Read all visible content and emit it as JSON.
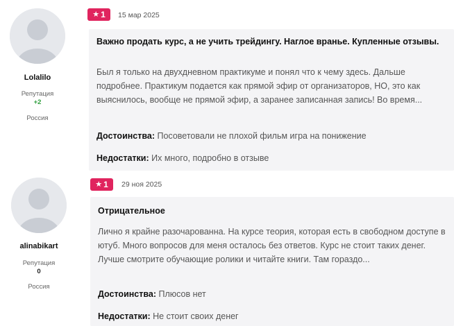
{
  "reviews": [
    {
      "rating": "1",
      "date": "15 мар 2025",
      "author": "Lolalilo",
      "reputation_label": "Репутация",
      "reputation": "+2",
      "reputation_color": "#2e9e3c",
      "country": "Россия",
      "title": "Важно продать курс, а не учить трейдингу. Наглое вранье. Купленные отзывы.",
      "text": "Был я только на двухдневном практикуме и понял что к чему здесь. Дальше подробнее. Практикум подается как прямой эфир от организаторов, НО, это как выяснилось, вообще не прямой эфир, а заранее записанная запись! Во время...",
      "pros_label": "Достоинства:",
      "pros": "Посоветовали не плохой фильм игра на понижение",
      "cons_label": "Недостатки:",
      "cons": "Их много, подробно в отзыве"
    },
    {
      "rating": "1",
      "date": "29 ноя 2025",
      "author": "alinabikart",
      "reputation_label": "Репутация",
      "reputation": "0",
      "reputation_color": "#222222",
      "country": "Россия",
      "title": "Отрицательное",
      "text": "Лично я крайне разочарованна. На курсе теория, которая есть в свободном доступе в ютуб. Много вопросов для меня осталось без ответов. Курс не стоит таких денег. Лучше смотрите обучающие ролики и читайте книги. Там гораздо...",
      "pros_label": "Достоинства:",
      "pros": "Плюсов нет",
      "cons_label": "Недостатки:",
      "cons": "Не стоит своих денег"
    }
  ],
  "colors": {
    "badge": "#e0245e",
    "card_bg": "#f4f4f6"
  },
  "icons": {
    "rating_star": "★",
    "avatar": "user-silhouette-icon"
  }
}
